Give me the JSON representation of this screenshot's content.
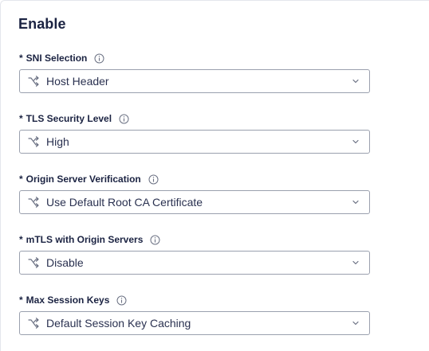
{
  "section": {
    "title": "Enable"
  },
  "fields": [
    {
      "required_mark": "*",
      "label": "SNI Selection",
      "value": "Host Header",
      "info_icon": "info-icon",
      "value_icon": "shuffle-icon"
    },
    {
      "required_mark": "*",
      "label": "TLS Security Level",
      "value": "High",
      "info_icon": "info-icon",
      "value_icon": "shuffle-icon"
    },
    {
      "required_mark": "*",
      "label": "Origin Server Verification",
      "value": "Use Default Root CA Certificate",
      "info_icon": "info-icon",
      "value_icon": "shuffle-icon"
    },
    {
      "required_mark": "*",
      "label": "mTLS with Origin Servers",
      "value": "Disable",
      "info_icon": "info-icon",
      "value_icon": "shuffle-icon"
    },
    {
      "required_mark": "*",
      "label": "Max Session Keys",
      "value": "Default Session Key Caching",
      "info_icon": "info-icon",
      "value_icon": "shuffle-icon"
    }
  ],
  "colors": {
    "text": "#1b2342",
    "border": "#9aa0ae",
    "icon": "#6b7183"
  }
}
